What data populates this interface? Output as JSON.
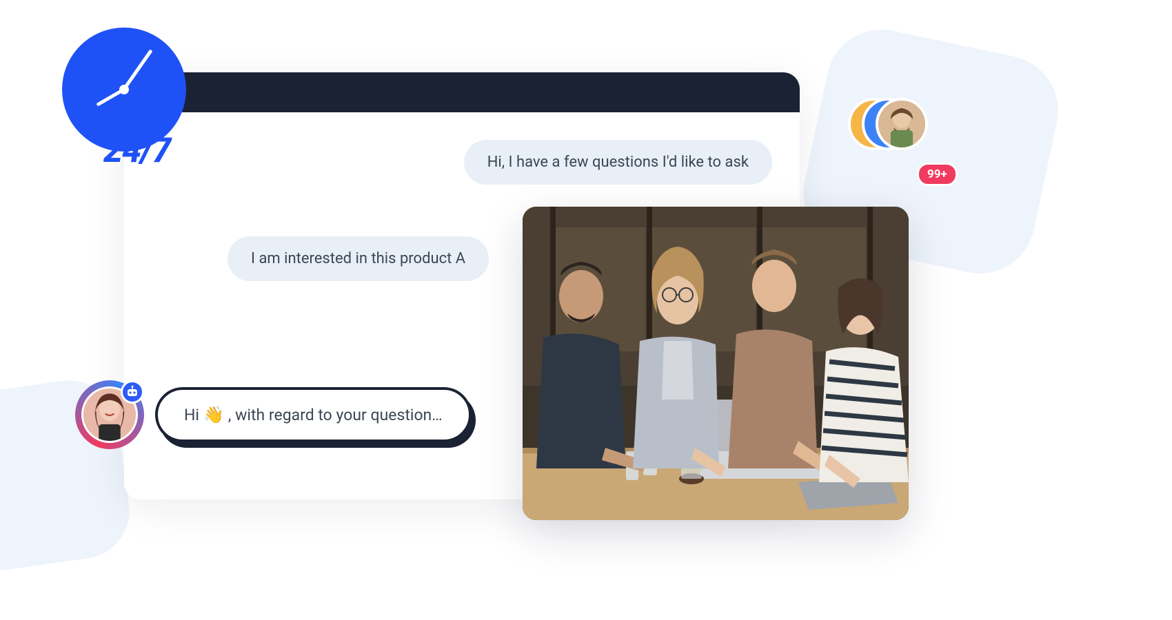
{
  "clock": {
    "label": "24/7"
  },
  "chat": {
    "bubbles": [
      "Hi, I have a few questions I'd like to ask",
      "I am interested in this product A",
      "I am interested in this pr"
    ],
    "reply_prefix": "Hi",
    "reply_suffix": " , with regard to your question…",
    "wave_emoji": "👋"
  },
  "badge": {
    "count": "99+"
  },
  "icons": {
    "customer_avatar": "customer-avatar",
    "agent_avatar": "agent-avatar",
    "bot": "bot-icon"
  },
  "colors": {
    "brand_blue": "#1f52f6",
    "bubble_bg": "#e9eff6",
    "dark": "#1b2233",
    "badge_red": "#f03a5f"
  }
}
